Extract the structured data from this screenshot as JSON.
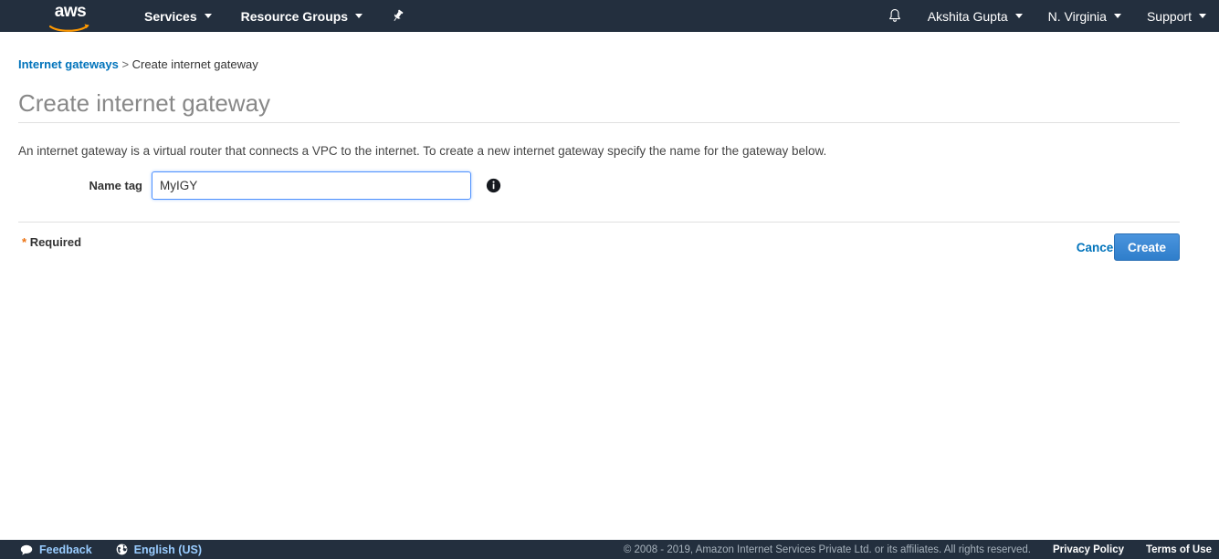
{
  "topnav": {
    "logo_text": "aws",
    "logo_icon": "aws-logo",
    "services_label": "Services",
    "resource_groups_label": "Resource Groups",
    "pin_icon": "pin-icon",
    "bell_icon": "bell-icon",
    "account_label": "Akshita Gupta",
    "region_label": "N. Virginia",
    "support_label": "Support"
  },
  "breadcrumb": {
    "parent_label": "Internet gateways",
    "separator": ">",
    "current_label": "Create internet gateway"
  },
  "page": {
    "title": "Create internet gateway",
    "description": "An internet gateway is a virtual router that connects a VPC to the internet. To create a new internet gateway specify the name for the gateway below."
  },
  "form": {
    "name_tag_label": "Name tag",
    "name_tag_value": "MyIGY",
    "name_tag_placeholder": "",
    "info_icon": "info-icon"
  },
  "actions": {
    "required_star": "*",
    "required_label": "Required",
    "cancel_label": "Cancel",
    "create_label": "Create"
  },
  "footer": {
    "feedback_label": "Feedback",
    "feedback_icon": "speech-bubble-icon",
    "language_label": "English (US)",
    "language_icon": "globe-icon",
    "copyright": "© 2008 - 2019, Amazon Internet Services Private Ltd. or its affiliates. All rights reserved.",
    "privacy_label": "Privacy Policy",
    "terms_label": "Terms of Use"
  },
  "colors": {
    "nav_background": "#232f3e",
    "link_blue": "#0073bb",
    "button_blue": "#2f7ecb",
    "accent_orange": "#ec7211",
    "title_gray": "#888888"
  }
}
